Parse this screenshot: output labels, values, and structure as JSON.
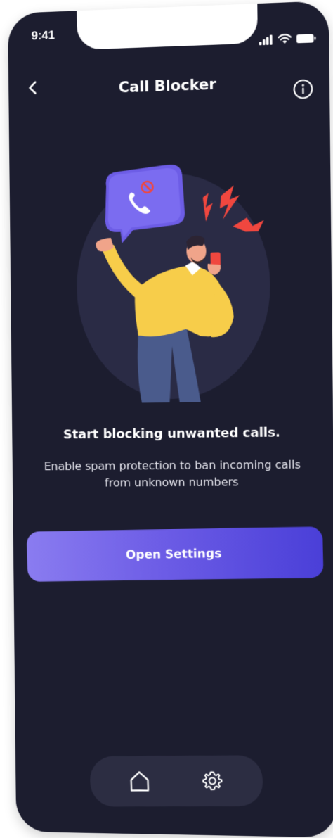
{
  "status_bar": {
    "time": "9:41",
    "icons": [
      "signal-icon",
      "wifi-icon",
      "battery-icon"
    ]
  },
  "header": {
    "title": "Call Blocker",
    "back_icon": "chevron-left-icon",
    "info_icon": "info-icon"
  },
  "illustration": {
    "description_icon": "blocked-call-icon"
  },
  "content": {
    "headline": "Start blocking unwanted calls.",
    "subtitle": "Enable spam protection to ban incoming calls from unknown numbers"
  },
  "cta": {
    "label": "Open Settings"
  },
  "bottom_nav": {
    "items": [
      {
        "icon": "home-icon"
      },
      {
        "icon": "gear-icon"
      }
    ]
  },
  "colors": {
    "background": "#1c1d2f",
    "accent": "#6d5de6",
    "accent_dark": "#4a3fd8",
    "alert_red": "#f0473f",
    "person_sweater": "#f7cd4a"
  }
}
